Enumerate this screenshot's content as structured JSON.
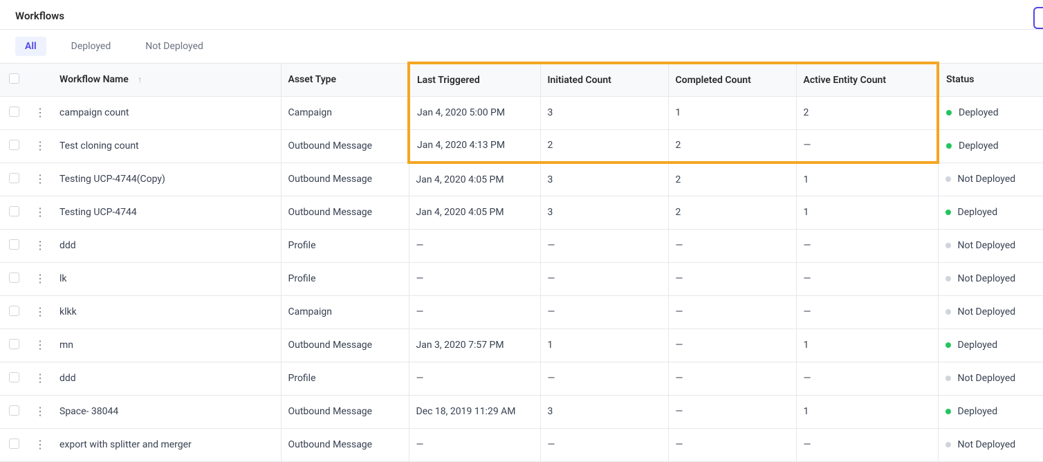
{
  "page_title": "Workflows",
  "tabs": {
    "all": "All",
    "deployed": "Deployed",
    "not_deployed": "Not Deployed",
    "active": "all"
  },
  "columns": {
    "name": "Workflow Name",
    "asset": "Asset Type",
    "triggered": "Last Triggered",
    "initiated": "Initiated Count",
    "completed": "Completed Count",
    "active": "Active Entity Count",
    "status": "Status"
  },
  "status_labels": {
    "deployed": "Deployed",
    "not_deployed": "Not Deployed"
  },
  "empty": "—",
  "rows": [
    {
      "name": "campaign count",
      "asset": "Campaign",
      "triggered": "Jan 4, 2020 5:00 PM",
      "initiated": "3",
      "completed": "1",
      "active": "2",
      "status": "deployed"
    },
    {
      "name": "Test cloning count",
      "asset": "Outbound Message",
      "triggered": "Jan 4, 2020 4:13 PM",
      "initiated": "2",
      "completed": "2",
      "active": "—",
      "status": "deployed"
    },
    {
      "name": "Testing UCP-4744(Copy)",
      "asset": "Outbound Message",
      "triggered": "Jan 4, 2020 4:05 PM",
      "initiated": "3",
      "completed": "2",
      "active": "1",
      "status": "not_deployed"
    },
    {
      "name": "Testing UCP-4744",
      "asset": "Outbound Message",
      "triggered": "Jan 4, 2020 4:05 PM",
      "initiated": "3",
      "completed": "2",
      "active": "1",
      "status": "deployed"
    },
    {
      "name": "ddd",
      "asset": "Profile",
      "triggered": "—",
      "initiated": "—",
      "completed": "—",
      "active": "—",
      "status": "not_deployed"
    },
    {
      "name": "lk",
      "asset": "Profile",
      "triggered": "—",
      "initiated": "—",
      "completed": "—",
      "active": "—",
      "status": "not_deployed"
    },
    {
      "name": "klkk",
      "asset": "Campaign",
      "triggered": "—",
      "initiated": "—",
      "completed": "—",
      "active": "—",
      "status": "not_deployed"
    },
    {
      "name": "mn",
      "asset": "Outbound Message",
      "triggered": "Jan 3, 2020 7:57 PM",
      "initiated": "1",
      "completed": "—",
      "active": "1",
      "status": "deployed"
    },
    {
      "name": "ddd",
      "asset": "Profile",
      "triggered": "—",
      "initiated": "—",
      "completed": "—",
      "active": "—",
      "status": "not_deployed"
    },
    {
      "name": "Space- 38044",
      "asset": "Outbound Message",
      "triggered": "Dec 18, 2019 11:29 AM",
      "initiated": "3",
      "completed": "—",
      "active": "1",
      "status": "deployed"
    },
    {
      "name": "export with splitter and merger",
      "asset": "Outbound Message",
      "triggered": "—",
      "initiated": "—",
      "completed": "—",
      "active": "—",
      "status": "not_deployed"
    }
  ],
  "highlight": {
    "first_row": 0,
    "last_row": 1
  }
}
